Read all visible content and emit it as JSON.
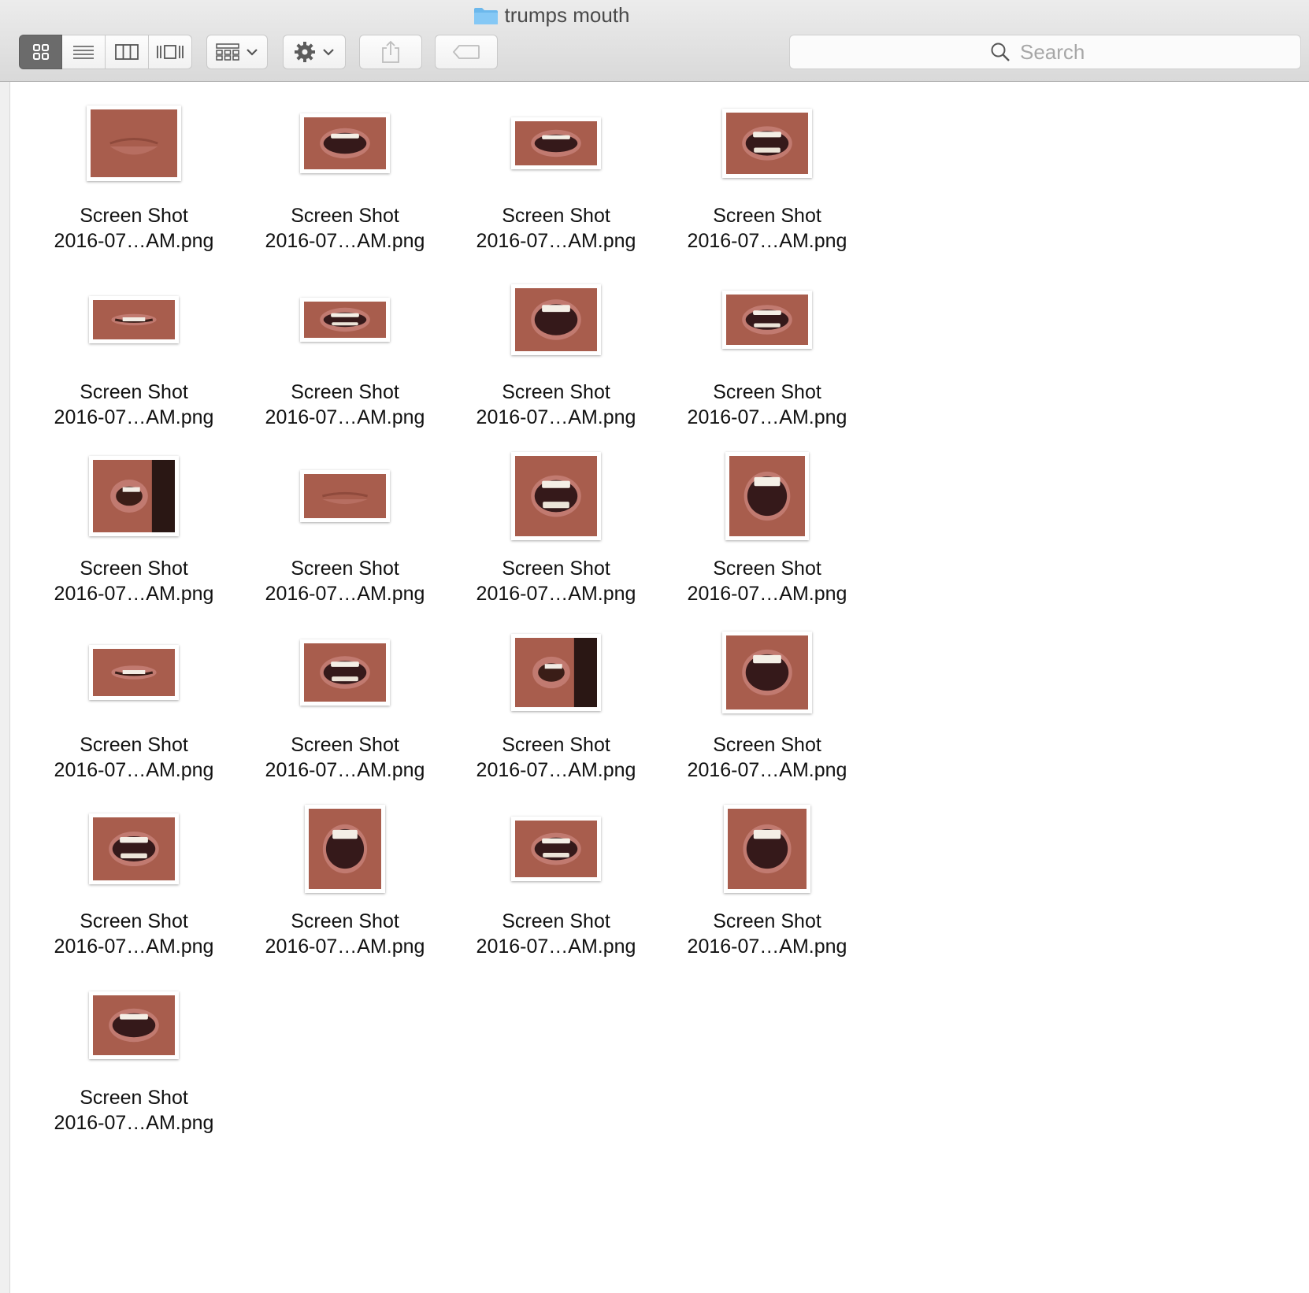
{
  "window": {
    "title": "trumps mouth"
  },
  "toolbar": {
    "view_modes": [
      "icon-view",
      "list-view",
      "column-view",
      "cover-flow-view"
    ],
    "active_view": "icon-view",
    "arrange_icon": "arrange-grid-icon",
    "action_icon": "gear-icon",
    "share_icon": "share-icon",
    "tag_icon": "tag-icon"
  },
  "search": {
    "placeholder": "Search"
  },
  "files": [
    {
      "line1": "Screen Shot",
      "line2": "2016-07…AM.png",
      "mouth": "closed"
    },
    {
      "line1": "Screen Shot",
      "line2": "2016-07…AM.png",
      "mouth": "open"
    },
    {
      "line1": "Screen Shot",
      "line2": "2016-07…AM.png",
      "mouth": "open"
    },
    {
      "line1": "Screen Shot",
      "line2": "2016-07…AM.png",
      "mouth": "teeth"
    },
    {
      "line1": "Screen Shot",
      "line2": "2016-07…AM.png",
      "mouth": "smile"
    },
    {
      "line1": "Screen Shot",
      "line2": "2016-07…AM.png",
      "mouth": "teeth"
    },
    {
      "line1": "Screen Shot",
      "line2": "2016-07…AM.png",
      "mouth": "wide"
    },
    {
      "line1": "Screen Shot",
      "line2": "2016-07…AM.png",
      "mouth": "teeth"
    },
    {
      "line1": "Screen Shot",
      "line2": "2016-07…AM.png",
      "mouth": "side"
    },
    {
      "line1": "Screen Shot",
      "line2": "2016-07…AM.png",
      "mouth": "closed"
    },
    {
      "line1": "Screen Shot",
      "line2": "2016-07…AM.png",
      "mouth": "teeth"
    },
    {
      "line1": "Screen Shot",
      "line2": "2016-07…AM.png",
      "mouth": "wide"
    },
    {
      "line1": "Screen Shot",
      "line2": "2016-07…AM.png",
      "mouth": "smile"
    },
    {
      "line1": "Screen Shot",
      "line2": "2016-07…AM.png",
      "mouth": "teeth"
    },
    {
      "line1": "Screen Shot",
      "line2": "2016-07…AM.png",
      "mouth": "side"
    },
    {
      "line1": "Screen Shot",
      "line2": "2016-07…AM.png",
      "mouth": "wide"
    },
    {
      "line1": "Screen Shot",
      "line2": "2016-07…AM.png",
      "mouth": "teeth"
    },
    {
      "line1": "Screen Shot",
      "line2": "2016-07…AM.png",
      "mouth": "wide"
    },
    {
      "line1": "Screen Shot",
      "line2": "2016-07…AM.png",
      "mouth": "teeth"
    },
    {
      "line1": "Screen Shot",
      "line2": "2016-07…AM.png",
      "mouth": "wide"
    },
    {
      "line1": "Screen Shot",
      "line2": "2016-07…AM.png",
      "mouth": "open"
    }
  ]
}
